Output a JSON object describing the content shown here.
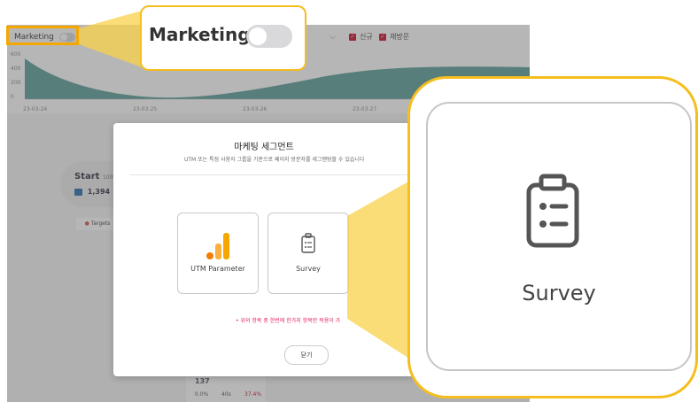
{
  "topbar": {
    "marketing_label": "Marketing",
    "checkbox_new": "신규",
    "checkbox_returning": "재방문"
  },
  "chart": {
    "y_ticks": [
      "600",
      "400",
      "200",
      "0"
    ],
    "x_ticks": [
      "23-03-24",
      "23-03-25",
      "23-03-26",
      "23-03-27"
    ]
  },
  "background": {
    "start_label": "Start",
    "start_pct": "100%",
    "start_count": "1,394",
    "targets_label": "Targets",
    "bottom_value": "137",
    "bottom_stats": [
      "0.0%",
      "40s",
      "37.4%"
    ]
  },
  "modal": {
    "title": "마케팅 세그먼트",
    "subtitle": "UTM 또는 특정 사용자 그룹을 기준으로 페이지 방문자를 세그멘팅할 수 있습니다",
    "options": [
      {
        "label": "UTM Parameter",
        "icon": "bar-chart-icon"
      },
      {
        "label": "Survey",
        "icon": "clipboard-list-icon"
      }
    ],
    "warning": "• 위의 항목 중 한번에 한가지 항목만 적용이 가",
    "close_label": "닫기"
  },
  "zoom_marketing": {
    "label": "Marketing",
    "toggle_on": false
  },
  "zoom_survey": {
    "label": "Survey",
    "icon": "clipboard-list-icon"
  },
  "colors": {
    "accent_orange": "#f5a700",
    "callout_border": "#f5be1f",
    "checkbox_red": "#c8102e",
    "warning_pink": "#e0245e",
    "chart_fill": "#3f8e88"
  }
}
